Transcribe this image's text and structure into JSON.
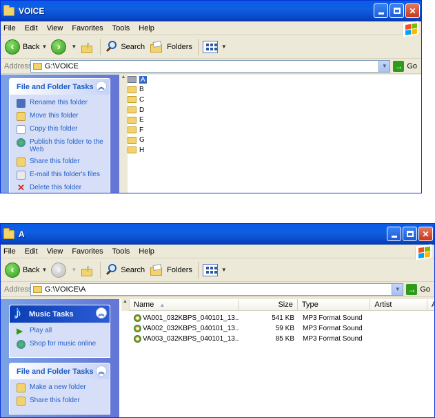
{
  "window1": {
    "title": "VOICE",
    "menu": [
      "File",
      "Edit",
      "View",
      "Favorites",
      "Tools",
      "Help"
    ],
    "toolbar": {
      "back": "Back",
      "search": "Search",
      "folders": "Folders"
    },
    "address_label": "Address",
    "address_value": "G:\\VOICE",
    "go": "Go",
    "task_panel": {
      "title": "File and Folder Tasks",
      "items": [
        {
          "label": "Rename this folder",
          "icon": "rename-icon"
        },
        {
          "label": "Move this folder",
          "icon": "move-icon"
        },
        {
          "label": "Copy this folder",
          "icon": "copy-icon"
        },
        {
          "label": "Publish this folder to the Web",
          "icon": "web-publish-icon"
        },
        {
          "label": "Share this folder",
          "icon": "share-icon"
        },
        {
          "label": "E-mail this folder's files",
          "icon": "email-icon"
        },
        {
          "label": "Delete this folder",
          "icon": "delete-icon"
        }
      ]
    },
    "folders": [
      "A",
      "B",
      "C",
      "D",
      "E",
      "F",
      "G",
      "H"
    ],
    "selected_folder": "A"
  },
  "window2": {
    "title": "A",
    "menu": [
      "File",
      "Edit",
      "View",
      "Favorites",
      "Tools",
      "Help"
    ],
    "toolbar": {
      "back": "Back",
      "search": "Search",
      "folders": "Folders"
    },
    "address_label": "Address",
    "address_value": "G:\\VOICE\\A",
    "go": "Go",
    "music_tasks": {
      "title": "Music Tasks",
      "items": [
        {
          "label": "Play all",
          "icon": "play-icon"
        },
        {
          "label": "Shop for music online",
          "icon": "globe-icon"
        }
      ]
    },
    "file_tasks": {
      "title": "File and Folder Tasks",
      "items": [
        {
          "label": "Make a new folder",
          "icon": "new-folder-icon"
        },
        {
          "label": "Share this folder",
          "icon": "share-icon"
        }
      ]
    },
    "columns": {
      "name": "Name",
      "size": "Size",
      "type": "Type",
      "artist": "Artist",
      "extra": "A"
    },
    "files": [
      {
        "name": "VA001_032KBPS_040101_13...",
        "size": "541 KB",
        "type": "MP3 Format Sound"
      },
      {
        "name": "VA002_032KBPS_040101_13...",
        "size": "59 KB",
        "type": "MP3 Format Sound"
      },
      {
        "name": "VA003_032KBPS_040101_13...",
        "size": "85 KB",
        "type": "MP3 Format Sound"
      }
    ]
  },
  "colors": {
    "titlebar": "#0a5ce6",
    "taskpane": "#7ba2e7",
    "link": "#215dc6",
    "selection": "#316ac5"
  }
}
